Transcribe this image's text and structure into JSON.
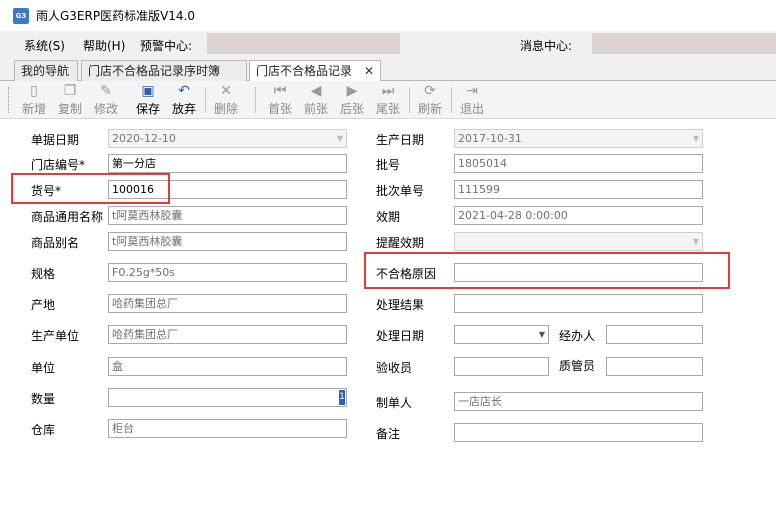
{
  "window": {
    "title": "雨人G3ERP医药标准版V14.0",
    "icon": "app-logo-icon"
  },
  "menu": {
    "system": "系统(S)",
    "help": "帮助(H)",
    "warning_center": "预警中心:",
    "message_center": "消息中心:"
  },
  "tabs": [
    {
      "label": "我的导航"
    },
    {
      "label": "门店不合格品记录序时簿"
    },
    {
      "label": "门店不合格品记录",
      "close": "✕"
    }
  ],
  "toolbar": {
    "new": "新增",
    "copy": "复制",
    "edit": "修改",
    "save": "保存",
    "discard": "放弃",
    "delete": "删除",
    "first": "首张",
    "prev": "前张",
    "next": "后张",
    "last": "尾张",
    "refresh": "刷新",
    "exit": "退出"
  },
  "form": {
    "doc_date": {
      "label": "单据日期",
      "value": "2020-12-10"
    },
    "store_no": {
      "label": "门店编号*",
      "value": "第一分店"
    },
    "item_no": {
      "label": "货号*",
      "value": "100016"
    },
    "generic_name": {
      "label": "商品通用名称",
      "value": "t阿莫西林胶囊"
    },
    "alias": {
      "label": "商品别名",
      "value": "t阿莫西林胶囊"
    },
    "spec": {
      "label": "规格",
      "value": "F0.25g*50s"
    },
    "origin": {
      "label": "产地",
      "value": "哈药集团总厂"
    },
    "manufacturer": {
      "label": "生产单位",
      "value": "哈药集团总厂"
    },
    "unit": {
      "label": "单位",
      "value": "盒"
    },
    "quantity": {
      "label": "数量",
      "value": "1"
    },
    "warehouse": {
      "label": "仓库",
      "value": "柜台"
    },
    "prod_date": {
      "label": "生产日期",
      "value": "2017-10-31"
    },
    "batch_no": {
      "label": "批号",
      "value": "1805014"
    },
    "batch_order_no": {
      "label": "批次单号",
      "value": "111599"
    },
    "expiry": {
      "label": "效期",
      "value": "2021-04-28 0:00:00"
    },
    "remind_expiry": {
      "label": "提醒效期",
      "value": ""
    },
    "reject_reason": {
      "label": "不合格原因",
      "value": ""
    },
    "result": {
      "label": "处理结果",
      "value": ""
    },
    "handle_date": {
      "label": "处理日期",
      "value": ""
    },
    "handler": {
      "label": "经办人",
      "value": ""
    },
    "receiver": {
      "label": "验收员",
      "value": ""
    },
    "qc": {
      "label": "质管员",
      "value": ""
    },
    "maker": {
      "label": "制单人",
      "value": "一店店长"
    },
    "remark": {
      "label": "备注",
      "value": ""
    }
  },
  "colors": {
    "highlight": "#e23b3b",
    "accent": "#2d62b8",
    "warning_box": "#dcd3d3"
  }
}
